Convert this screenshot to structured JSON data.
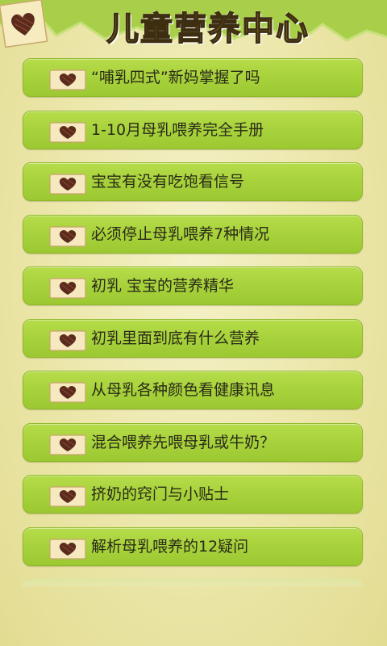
{
  "header": {
    "title": "儿童营养中心",
    "logo_icon": "heart-note-icon"
  },
  "list": {
    "items": [
      {
        "label": "“哺乳四式”新妈掌握了吗",
        "icon": "heart-note-icon"
      },
      {
        "label": "1-10月母乳喂养完全手册",
        "icon": "heart-note-icon"
      },
      {
        "label": "宝宝有没有吃饱看信号",
        "icon": "heart-note-icon"
      },
      {
        "label": "必须停止母乳喂养7种情况",
        "icon": "heart-note-icon"
      },
      {
        "label": "初乳 宝宝的营养精华",
        "icon": "heart-note-icon"
      },
      {
        "label": "初乳里面到底有什么营养",
        "icon": "heart-note-icon"
      },
      {
        "label": "从母乳各种颜色看健康讯息",
        "icon": "heart-note-icon"
      },
      {
        "label": "混合喂养先喂母乳或牛奶？",
        "icon": "heart-note-icon"
      },
      {
        "label": "挤奶的窍门与小贴士",
        "icon": "heart-note-icon"
      },
      {
        "label": "解析母乳喂养的12疑问",
        "icon": "heart-note-icon"
      }
    ]
  },
  "colors": {
    "item_green": "#a6d13a",
    "background": "#ebe6a8",
    "mountain_green": "#a9cf4a",
    "title_gold": "#b59a3a"
  }
}
